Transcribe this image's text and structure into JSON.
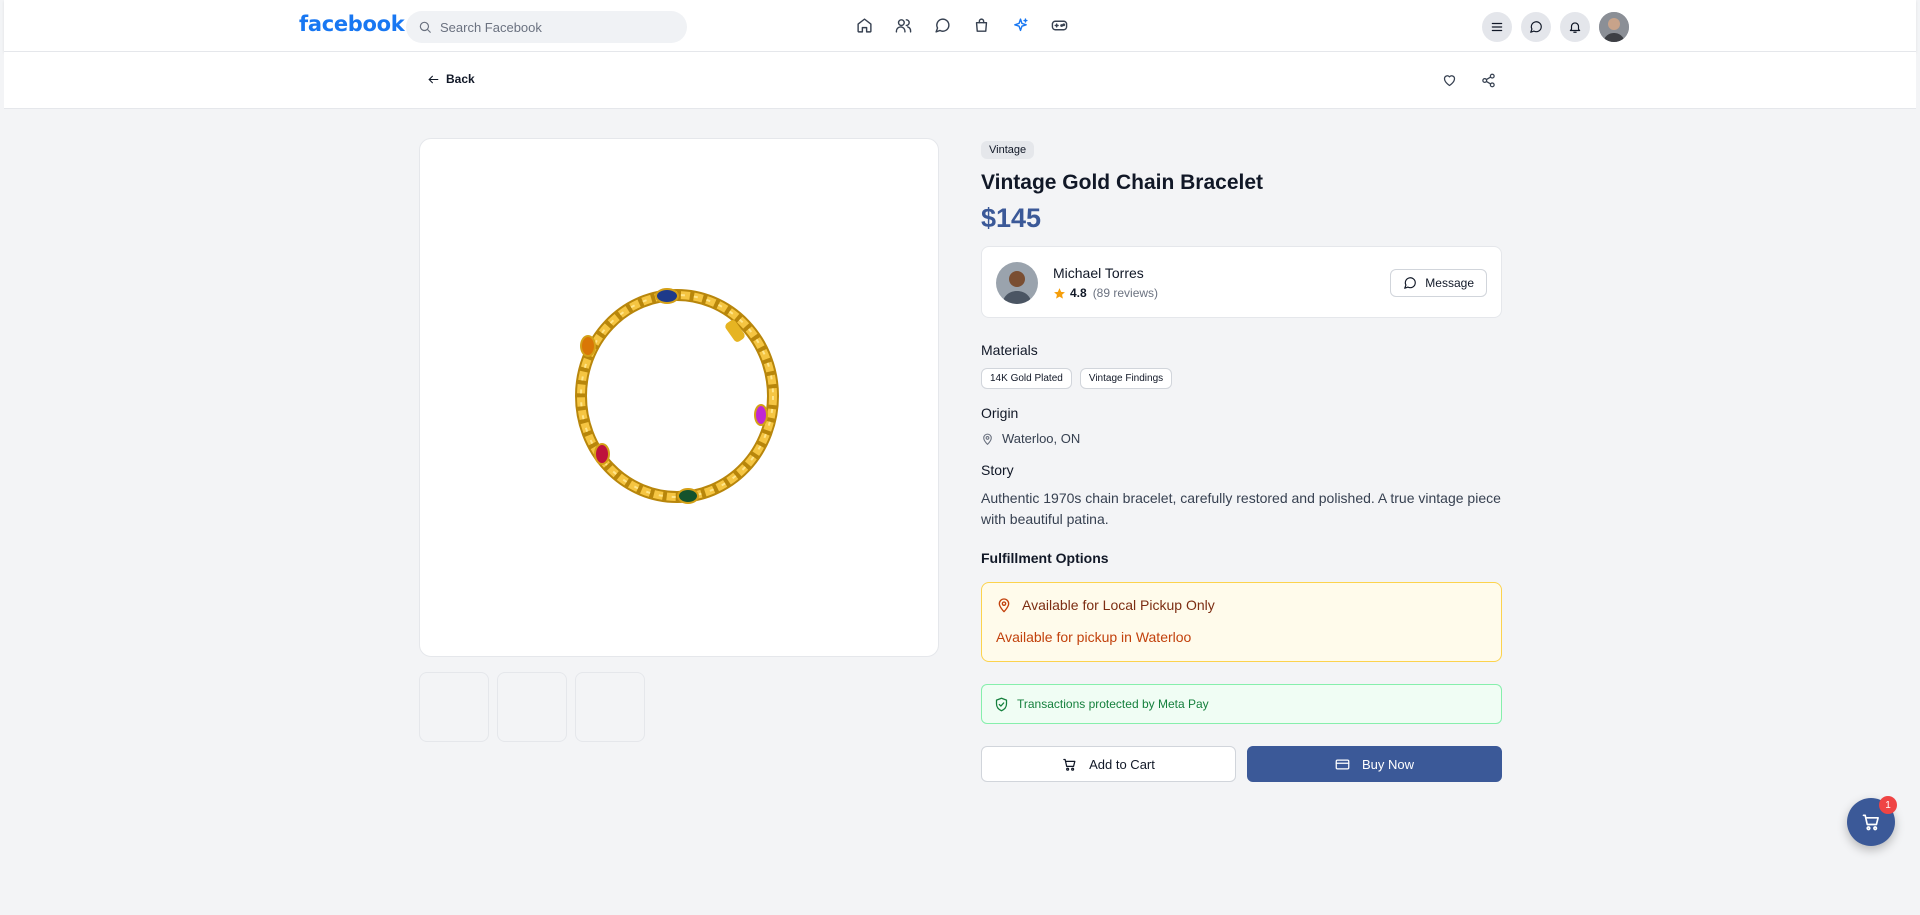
{
  "nav": {
    "logo": "facebook",
    "search_placeholder": "Search Facebook",
    "icons": [
      "home-icon",
      "friends-icon",
      "messenger-icon",
      "marketplace-icon",
      "sparkle-icon",
      "gaming-icon"
    ],
    "active_icon": "sparkle-icon",
    "right_icons": [
      "menu-icon",
      "messenger-icon",
      "bell-icon",
      "profile-avatar"
    ]
  },
  "subheader": {
    "back_label": "Back",
    "actions": [
      "heart-icon",
      "share-icon"
    ]
  },
  "product": {
    "badge": "Vintage",
    "title": "Vintage Gold Chain Bracelet",
    "price": "$145",
    "thumbnails": 3
  },
  "seller": {
    "name": "Michael Torres",
    "rating": "4.8",
    "reviews": "(89 reviews)",
    "message_label": "Message"
  },
  "materials": {
    "heading": "Materials",
    "items": [
      "14K Gold Plated",
      "Vintage Findings"
    ]
  },
  "origin": {
    "heading": "Origin",
    "location": "Waterloo, ON"
  },
  "story": {
    "heading": "Story",
    "text": "Authentic 1970s chain bracelet, carefully restored and polished. A true vintage piece with beautiful patina."
  },
  "fulfillment": {
    "heading": "Fulfillment Options",
    "title": "Available for Local Pickup Only",
    "subtitle": "Available for pickup in Waterloo"
  },
  "protection": {
    "text": "Transactions protected by Meta Pay"
  },
  "actions": {
    "add_to_cart": "Add to Cart",
    "buy_now": "Buy Now"
  },
  "cart": {
    "count": "1"
  },
  "colors": {
    "brand": "#1877f2",
    "accent": "#3b5998",
    "pickup_bg": "#fffbeb",
    "protect_text": "#15803d"
  }
}
